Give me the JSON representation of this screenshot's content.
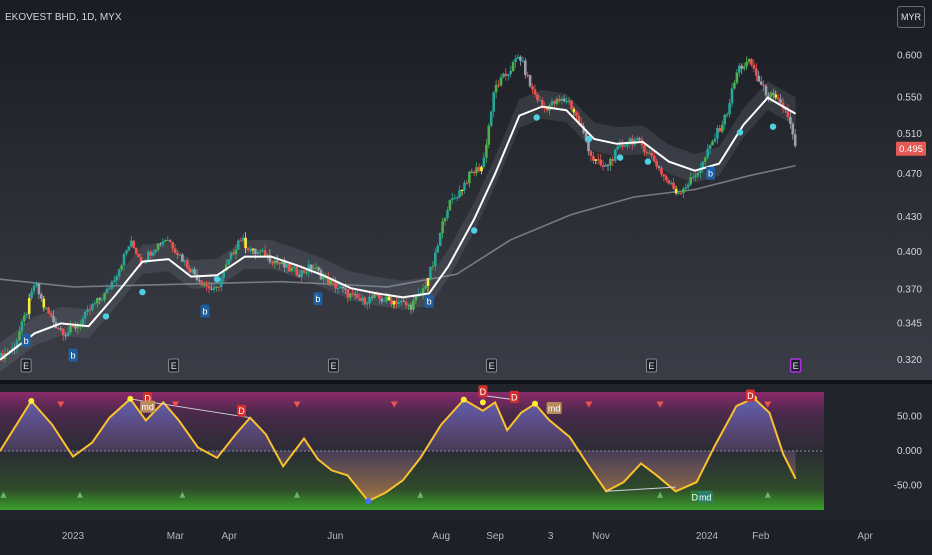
{
  "title": "EKOVEST BHD, 1D, MYX",
  "currency_button": "MYR",
  "colors": {
    "up": "#26a69a",
    "up_bright": "#4caf50",
    "down": "#ef5350",
    "neutral": "#9aa1ad",
    "highlight": "#ffeb3b",
    "ma": "#ffffff",
    "slow_ma": "#8a8d96",
    "dot": "#4dd0e1",
    "osc_line": "#fbc02d",
    "osc_fill_top": "#5c6bc0",
    "price_label": "#e35a56"
  },
  "chart_data": {
    "type": "candlestick",
    "y_ticks": [
      "0.600",
      "0.550",
      "0.510",
      "0.470",
      "0.430",
      "0.400",
      "0.370",
      "0.345",
      "0.320"
    ],
    "last_price": "0.495",
    "ylim": [
      0.312,
      0.63
    ],
    "x_ticks": [
      "2023",
      "Mar",
      "Apr",
      "Jun",
      "Aug",
      "Sep",
      "3",
      "Nov",
      "2024",
      "Feb",
      "Apr"
    ],
    "x_range": [
      "2022-11-20",
      "2024-04-05"
    ],
    "price_path": [
      [
        "2022-11-20",
        0.322
      ],
      [
        "2022-11-28",
        0.328
      ],
      [
        "2022-12-05",
        0.352
      ],
      [
        "2022-12-10",
        0.375
      ],
      [
        "2022-12-15",
        0.358
      ],
      [
        "2022-12-22",
        0.344
      ],
      [
        "2022-12-28",
        0.338
      ],
      [
        "2023-01-05",
        0.345
      ],
      [
        "2023-01-12",
        0.357
      ],
      [
        "2023-01-20",
        0.367
      ],
      [
        "2023-01-27",
        0.385
      ],
      [
        "2023-02-03",
        0.408
      ],
      [
        "2023-02-10",
        0.392
      ],
      [
        "2023-02-17",
        0.404
      ],
      [
        "2023-02-24",
        0.412
      ],
      [
        "2023-03-03",
        0.398
      ],
      [
        "2023-03-10",
        0.385
      ],
      [
        "2023-03-17",
        0.375
      ],
      [
        "2023-03-24",
        0.368
      ],
      [
        "2023-03-31",
        0.39
      ],
      [
        "2023-04-07",
        0.412
      ],
      [
        "2023-04-14",
        0.4
      ],
      [
        "2023-04-21",
        0.398
      ],
      [
        "2023-04-28",
        0.392
      ],
      [
        "2023-05-05",
        0.386
      ],
      [
        "2023-05-12",
        0.383
      ],
      [
        "2023-05-19",
        0.388
      ],
      [
        "2023-05-26",
        0.378
      ],
      [
        "2023-06-02",
        0.372
      ],
      [
        "2023-06-09",
        0.366
      ],
      [
        "2023-06-16",
        0.361
      ],
      [
        "2023-06-23",
        0.364
      ],
      [
        "2023-06-30",
        0.362
      ],
      [
        "2023-07-07",
        0.361
      ],
      [
        "2023-07-14",
        0.357
      ],
      [
        "2023-07-21",
        0.368
      ],
      [
        "2023-07-28",
        0.392
      ],
      [
        "2023-08-04",
        0.438
      ],
      [
        "2023-08-11",
        0.452
      ],
      [
        "2023-08-18",
        0.47
      ],
      [
        "2023-08-25",
        0.478
      ],
      [
        "2023-09-01",
        0.562
      ],
      [
        "2023-09-08",
        0.578
      ],
      [
        "2023-09-15",
        0.6
      ],
      [
        "2023-09-22",
        0.56
      ],
      [
        "2023-09-29",
        0.538
      ],
      [
        "2023-10-06",
        0.545
      ],
      [
        "2023-10-13",
        0.548
      ],
      [
        "2023-10-20",
        0.52
      ],
      [
        "2023-10-27",
        0.485
      ],
      [
        "2023-11-03",
        0.475
      ],
      [
        "2023-11-10",
        0.492
      ],
      [
        "2023-11-17",
        0.505
      ],
      [
        "2023-11-24",
        0.5
      ],
      [
        "2023-12-01",
        0.485
      ],
      [
        "2023-12-08",
        0.465
      ],
      [
        "2023-12-15",
        0.452
      ],
      [
        "2023-12-22",
        0.462
      ],
      [
        "2023-12-29",
        0.478
      ],
      [
        "2024-01-05",
        0.505
      ],
      [
        "2024-01-12",
        0.53
      ],
      [
        "2024-01-19",
        0.585
      ],
      [
        "2024-01-26",
        0.592
      ],
      [
        "2024-02-02",
        0.56
      ],
      [
        "2024-02-09",
        0.548
      ],
      [
        "2024-02-16",
        0.535
      ],
      [
        "2024-02-21",
        0.495
      ]
    ],
    "ma_path": [
      [
        "2022-11-20",
        0.32
      ],
      [
        "2022-12-10",
        0.338
      ],
      [
        "2022-12-25",
        0.345
      ],
      [
        "2023-01-10",
        0.343
      ],
      [
        "2023-01-25",
        0.365
      ],
      [
        "2023-02-10",
        0.392
      ],
      [
        "2023-02-25",
        0.394
      ],
      [
        "2023-03-10",
        0.38
      ],
      [
        "2023-03-25",
        0.381
      ],
      [
        "2023-04-10",
        0.396
      ],
      [
        "2023-04-25",
        0.396
      ],
      [
        "2023-05-10",
        0.389
      ],
      [
        "2023-05-25",
        0.381
      ],
      [
        "2023-06-10",
        0.371
      ],
      [
        "2023-06-25",
        0.367
      ],
      [
        "2023-07-10",
        0.364
      ],
      [
        "2023-07-25",
        0.367
      ],
      [
        "2023-08-05",
        0.388
      ],
      [
        "2023-08-20",
        0.428
      ],
      [
        "2023-09-01",
        0.47
      ],
      [
        "2023-09-15",
        0.53
      ],
      [
        "2023-09-28",
        0.54
      ],
      [
        "2023-10-12",
        0.536
      ],
      [
        "2023-10-28",
        0.505
      ],
      [
        "2023-11-10",
        0.5
      ],
      [
        "2023-11-25",
        0.502
      ],
      [
        "2023-12-10",
        0.482
      ],
      [
        "2023-12-25",
        0.473
      ],
      [
        "2024-01-08",
        0.48
      ],
      [
        "2024-01-22",
        0.52
      ],
      [
        "2024-02-05",
        0.55
      ],
      [
        "2024-02-21",
        0.532
      ]
    ],
    "slow_ma_path": [
      [
        "2022-11-20",
        0.378
      ],
      [
        "2023-01-01",
        0.372
      ],
      [
        "2023-03-01",
        0.374
      ],
      [
        "2023-05-01",
        0.376
      ],
      [
        "2023-07-01",
        0.372
      ],
      [
        "2023-08-10",
        0.382
      ],
      [
        "2023-09-10",
        0.41
      ],
      [
        "2023-10-15",
        0.432
      ],
      [
        "2023-11-20",
        0.448
      ],
      [
        "2023-12-25",
        0.455
      ],
      [
        "2024-01-25",
        0.468
      ],
      [
        "2024-02-21",
        0.478
      ]
    ],
    "markers_b": [
      "2022-12-05",
      "2023-01-01",
      "2023-03-18",
      "2023-05-22",
      "2023-07-25",
      "2024-01-03"
    ],
    "markers_e": [
      "2022-12-05",
      "2023-02-28",
      "2023-05-31",
      "2023-08-30",
      "2023-11-30",
      "2024-02-21"
    ],
    "dots": [
      [
        "2023-01-20",
        0.35
      ],
      [
        "2023-02-10",
        0.368
      ],
      [
        "2023-03-25",
        0.378
      ],
      [
        "2023-08-20",
        0.418
      ],
      [
        "2023-09-25",
        0.528
      ],
      [
        "2023-10-25",
        0.505
      ],
      [
        "2023-11-12",
        0.486
      ],
      [
        "2023-11-28",
        0.482
      ],
      [
        "2024-01-20",
        0.512
      ],
      [
        "2024-02-08",
        0.518
      ]
    ],
    "oscillator": {
      "y_ticks": [
        "50.00",
        "0.000",
        "-50.00"
      ],
      "ylim": [
        -85,
        85
      ],
      "path": [
        [
          "2022-11-20",
          0
        ],
        [
          "2022-11-30",
          40
        ],
        [
          "2022-12-08",
          72
        ],
        [
          "2022-12-20",
          38
        ],
        [
          "2023-01-01",
          -8
        ],
        [
          "2023-01-12",
          12
        ],
        [
          "2023-01-22",
          48
        ],
        [
          "2023-02-03",
          75
        ],
        [
          "2023-02-12",
          44
        ],
        [
          "2023-02-22",
          70
        ],
        [
          "2023-03-03",
          44
        ],
        [
          "2023-03-14",
          5
        ],
        [
          "2023-03-25",
          -10
        ],
        [
          "2023-04-05",
          25
        ],
        [
          "2023-04-13",
          48
        ],
        [
          "2023-04-22",
          24
        ],
        [
          "2023-05-02",
          -22
        ],
        [
          "2023-05-14",
          18
        ],
        [
          "2023-05-22",
          -12
        ],
        [
          "2023-05-30",
          -28
        ],
        [
          "2023-06-08",
          -35
        ],
        [
          "2023-06-20",
          -72
        ],
        [
          "2023-06-30",
          -60
        ],
        [
          "2023-07-10",
          -42
        ],
        [
          "2023-07-20",
          -10
        ],
        [
          "2023-08-01",
          38
        ],
        [
          "2023-08-14",
          74
        ],
        [
          "2023-08-25",
          58
        ],
        [
          "2023-09-01",
          70
        ],
        [
          "2023-09-08",
          30
        ],
        [
          "2023-09-16",
          55
        ],
        [
          "2023-09-24",
          68
        ],
        [
          "2023-10-02",
          45
        ],
        [
          "2023-10-14",
          20
        ],
        [
          "2023-10-25",
          -22
        ],
        [
          "2023-11-04",
          -58
        ],
        [
          "2023-11-14",
          -45
        ],
        [
          "2023-11-24",
          -18
        ],
        [
          "2023-12-03",
          -35
        ],
        [
          "2023-12-14",
          -58
        ],
        [
          "2023-12-26",
          -45
        ],
        [
          "2024-01-06",
          10
        ],
        [
          "2024-01-18",
          65
        ],
        [
          "2024-01-28",
          76
        ],
        [
          "2024-02-06",
          55
        ],
        [
          "2024-02-14",
          -5
        ],
        [
          "2024-02-21",
          -40
        ]
      ],
      "signal_labels": [
        {
          "date": "2023-02-13",
          "text": "D",
          "value": 76,
          "color": "#d32f2f"
        },
        {
          "date": "2023-02-13",
          "text": "md",
          "value": 64,
          "color": "#b88b5c"
        },
        {
          "date": "2023-04-08",
          "text": "D",
          "value": 58,
          "color": "#d32f2f"
        },
        {
          "date": "2023-08-25",
          "text": "D",
          "value": 86,
          "color": "#d32f2f"
        },
        {
          "date": "2023-09-12",
          "text": "D",
          "value": 78,
          "color": "#d32f2f"
        },
        {
          "date": "2023-10-05",
          "text": "md",
          "value": 62,
          "color": "#b88b5c"
        },
        {
          "date": "2024-01-26",
          "text": "D",
          "value": 80,
          "color": "#d32f2f"
        },
        {
          "date": "2023-12-25",
          "text": "D",
          "value": -66,
          "color": "#2e7d32"
        },
        {
          "date": "2023-12-31",
          "text": "md",
          "value": -66,
          "color": "#2e7d6a"
        }
      ],
      "down_triangles": [
        "2022-12-25",
        "2023-03-01",
        "2023-05-10",
        "2023-07-05",
        "2023-10-25",
        "2023-12-05",
        "2024-02-05"
      ],
      "up_triangles": [
        "2022-11-22",
        "2023-01-05",
        "2023-03-05",
        "2023-05-10",
        "2023-07-20",
        "2023-12-05",
        "2024-02-05"
      ]
    }
  }
}
